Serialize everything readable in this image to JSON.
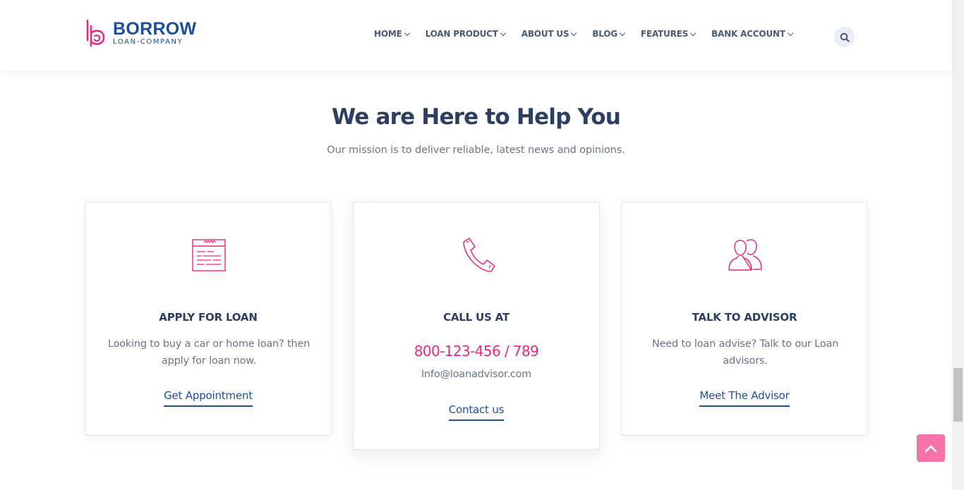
{
  "brand": {
    "name": "BORROW",
    "tagline": "LOAN-COMPANY",
    "primary_color": "#1d4e9c",
    "accent_color": "#e6297c"
  },
  "nav": {
    "items": [
      {
        "label": "HOME"
      },
      {
        "label": "LOAN PRODUCT"
      },
      {
        "label": "ABOUT US"
      },
      {
        "label": "BLOG"
      },
      {
        "label": "FEATURES"
      },
      {
        "label": "BANK ACCOUNT"
      }
    ],
    "search_icon": "search-icon"
  },
  "section": {
    "title": "We are Here to Help You",
    "subtitle": "Our mission is to deliver reliable, latest news and opinions."
  },
  "cards": [
    {
      "icon": "loan-form-icon",
      "title": "APPLY FOR LOAN",
      "description": "Looking to buy a car or home loan? then apply for loan now.",
      "link": "Get Appointment"
    },
    {
      "icon": "phone-icon",
      "title": "CALL US AT",
      "phone": "800-123-456 / 789",
      "email": "Info@loanadvisor.com",
      "link": "Contact us"
    },
    {
      "icon": "advisor-users-icon",
      "title": "TALK TO ADVISOR",
      "description": "Need to loan advise? Talk to our Loan advisors.",
      "link": "Meet The Advisor"
    }
  ],
  "back_to_top": {
    "icon": "chevron-up-icon"
  }
}
